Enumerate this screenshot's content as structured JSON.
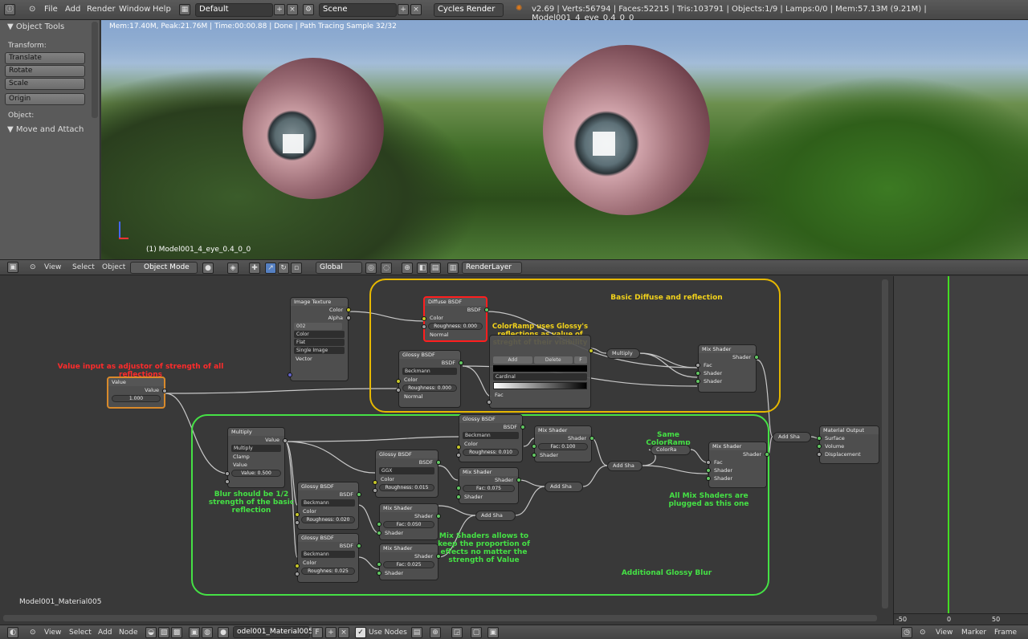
{
  "menubar": {
    "items": [
      "File",
      "Add",
      "Render",
      "Window",
      "Help"
    ],
    "layout": "Default",
    "scene": "Scene",
    "engine": "Cycles Render",
    "stats": "v2.69 | Verts:56794 | Faces:52215 | Tris:103791 | Objects:1/9 | Lamps:0/0 | Mem:57.13M (9.21M) | Model001_4_eye_0.4_0_0"
  },
  "toolshelf": {
    "title": "Object Tools",
    "transform_label": "Transform:",
    "translate": "Translate",
    "rotate": "Rotate",
    "scale": "Scale",
    "origin": "Origin",
    "object_label": "Object:",
    "move_attach": "Move and Attach"
  },
  "viewport": {
    "render_info": "Mem:17.40M, Peak:21.76M | Time:00:00.88 | Done | Path Tracing Sample 32/32",
    "object_name": "(1) Model001_4_eye_0.4_0_0"
  },
  "view_header": {
    "view": "View",
    "select": "Select",
    "object": "Object",
    "mode": "Object Mode",
    "orientation": "Global",
    "render_layer": "RenderLayer"
  },
  "nodes": {
    "image_texture": {
      "title": "Image Texture",
      "color": "Color",
      "alpha": "Alpha",
      "count": "002",
      "color_mode": "Color",
      "projection": "Flat",
      "image_mode": "Single Image",
      "vector": "Vector"
    },
    "diffuse": {
      "title": "Diffuse BSDF",
      "bsdf": "BSDF",
      "color": "Color",
      "roughness": "Roughness: 0.000",
      "normal": "Normal"
    },
    "glossy_main": {
      "title": "Glossy BSDF",
      "bsdf": "BSDF",
      "dist": "Beckmann",
      "color": "Color",
      "roughness": "Roughness: 0.000",
      "normal": "Normal"
    },
    "colorramp": {
      "add": "Add",
      "delete": "Delete",
      "f": "F",
      "interp": "Cardinal",
      "fac": "Fac"
    },
    "multiply_top": {
      "label": "Multiply"
    },
    "mix_top": {
      "title": "Mix Shader",
      "shader": "Shader",
      "fac": "Fac",
      "shader1": "Shader",
      "shader2": "Shader"
    },
    "value": {
      "title": "Value",
      "out": "Value",
      "val": "1.000"
    },
    "math_multiply": {
      "title": "Multiply",
      "out": "Value",
      "op": "Multiply",
      "clamp": "Clamp",
      "in": "Value",
      "val": "Value: 0.500"
    },
    "glossy_b1": {
      "title": "Glossy BSDF",
      "bsdf": "BSDF",
      "dist": "Beckmann",
      "color": "Color",
      "roughness": "Roughness: 0.010"
    },
    "glossy_b2": {
      "title": "Glossy BSDF",
      "bsdf": "BSDF",
      "dist": "GGX",
      "color": "Color",
      "roughness": "Roughness: 0.015"
    },
    "glossy_b3": {
      "title": "Glossy BSDF",
      "bsdf": "BSDF",
      "dist": "Beckmann",
      "color": "Color",
      "roughness": "Roughness: 0.020"
    },
    "glossy_b4": {
      "title": "Glossy BSDF",
      "bsdf": "BSDF",
      "dist": "Beckmann",
      "color": "Color",
      "roughness": "Roughnes: 0.025"
    },
    "mix_b1": {
      "title": "Mix Shader",
      "shader": "Shader",
      "fac": "Fac: 0.100",
      "s": "Shader"
    },
    "mix_b2": {
      "title": "Mix Shader",
      "shader": "Shader",
      "fac": "Fac: 0.075",
      "s": "Shader"
    },
    "mix_b3": {
      "title": "Mix Shader",
      "shader": "Shader",
      "fac": "Fac: 0.050",
      "s": "Shader"
    },
    "mix_b4": {
      "title": "Mix Shader",
      "shader": "Shader",
      "fac": "Fac: 0.025",
      "s": "Shader"
    },
    "addsha": "Add Sha",
    "colorramp_small": "ColorRa",
    "mix_bottom": {
      "title": "Mix Shader",
      "shader": "Shader",
      "fac": "Fac",
      "shader1": "Shader",
      "shader2": "Shader"
    },
    "material_output": {
      "title": "Material Output",
      "surface": "Surface",
      "volume": "Volume",
      "displacement": "Displacement"
    }
  },
  "annotations": {
    "basic": "Basic Diffuse and reflection",
    "colorramp_note": "ColorRamp uses Glossy's reflections as value of streght of their visibility",
    "value_note": "Value input as adjustor of strength of all reflections",
    "same_colorramp": "Same ColorRamp",
    "blur_note": "Blur should be 1/2 strength of the basic reflection",
    "all_mix": "All Mix Shaders are plugged as this one",
    "mix_note": "Mix Shaders allows to keep the proportion of effects no matter the strength of Value",
    "additional": "Additional Glossy Blur"
  },
  "material_name": "Model001_Material005",
  "timeline": {
    "ticks": [
      "-50",
      "0",
      "50"
    ]
  },
  "bottombar": {
    "view": "View",
    "select": "Select",
    "add": "Add",
    "node": "Node",
    "material": "odel001_Material005",
    "f": "F",
    "use_nodes": "Use Nodes",
    "tl_view": "View",
    "marker": "Marker",
    "frame": "Frame"
  }
}
